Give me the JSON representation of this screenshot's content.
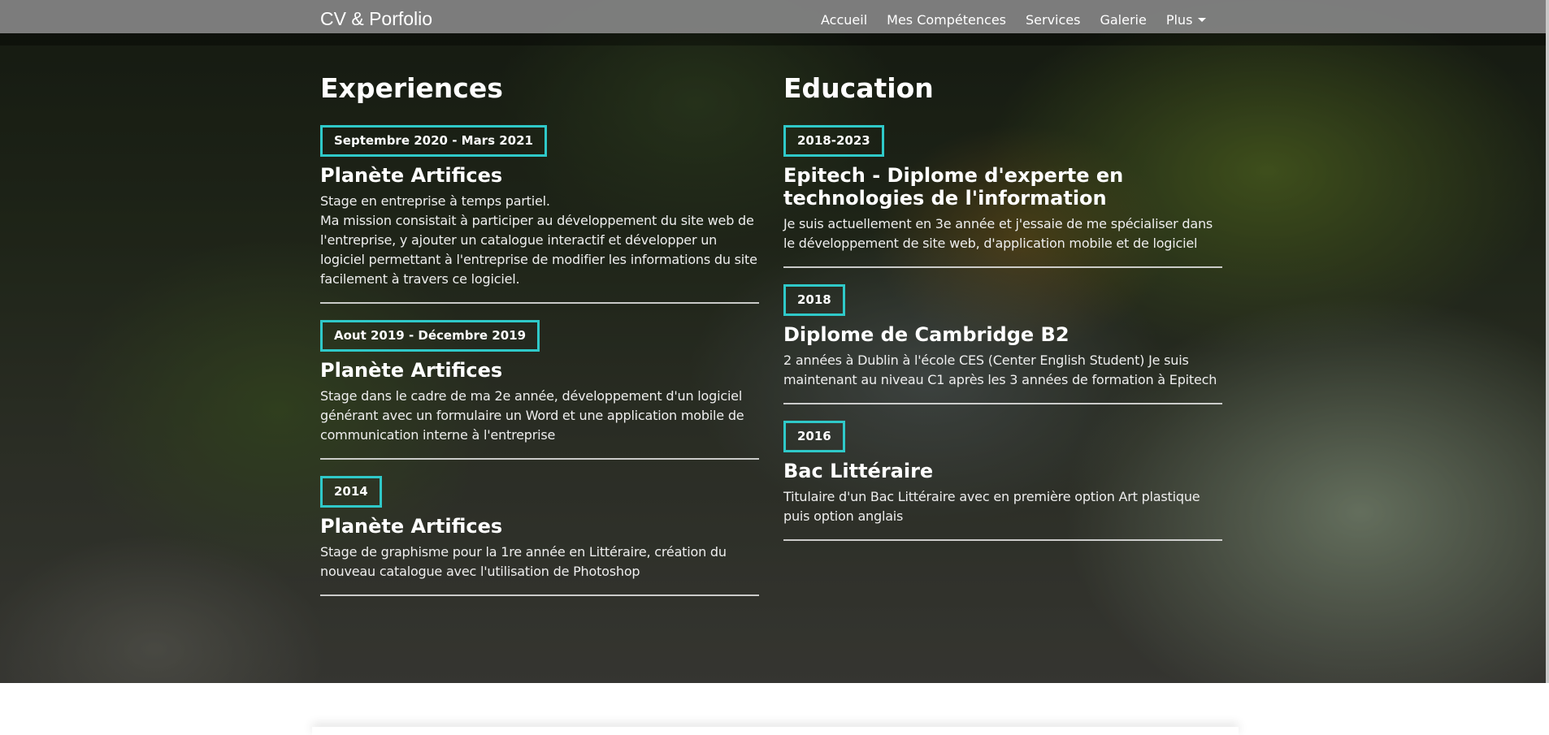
{
  "navbar": {
    "brand": "CV & Porfolio",
    "links": [
      "Accueil",
      "Mes Compétences",
      "Services",
      "Galerie",
      "Plus"
    ]
  },
  "experiences": {
    "title": "Experiences",
    "items": [
      {
        "date": "Septembre 2020 - Mars 2021",
        "company": "Planète Artifices",
        "description": "Stage en entreprise à temps partiel.\nMa mission consistait à participer au développement du site web de l'entreprise, y ajouter un catalogue interactif et développer un logiciel permettant à l'entreprise de modifier les informations du site facilement à travers ce logiciel."
      },
      {
        "date": "Aout 2019 - Décembre 2019",
        "company": "Planète Artifices",
        "description": "Stage dans le cadre de ma 2e année, développement d'un logiciel générant avec un formulaire un Word et une application mobile de communication interne à l'entreprise"
      },
      {
        "date": "2014",
        "company": "Planète Artifices",
        "description": "Stage de graphisme pour la 1re année en Littéraire, création du nouveau catalogue avec l'utilisation de Photoshop"
      }
    ]
  },
  "education": {
    "title": "Education",
    "items": [
      {
        "date": "2018-2023",
        "degree": "Epitech - Diplome d'experte en technologies de l'information",
        "description": "Je suis actuellement en 3e année et j'essaie de me spécialiser dans le développement de site web, d'application mobile et de logiciel"
      },
      {
        "date": "2018",
        "degree": "Diplome de Cambridge B2",
        "description": "2 années à Dublin à l'école CES (Center English Student) Je suis maintenant au niveau C1 après les 3 années de formation à Epitech"
      },
      {
        "date": "2016",
        "degree": "Bac Littéraire",
        "description": "Titulaire d'un Bac Littéraire avec en première option Art plastique puis option anglais"
      }
    ]
  },
  "colors": {
    "accent": "#2fc9c9",
    "navbar": "#808080"
  }
}
